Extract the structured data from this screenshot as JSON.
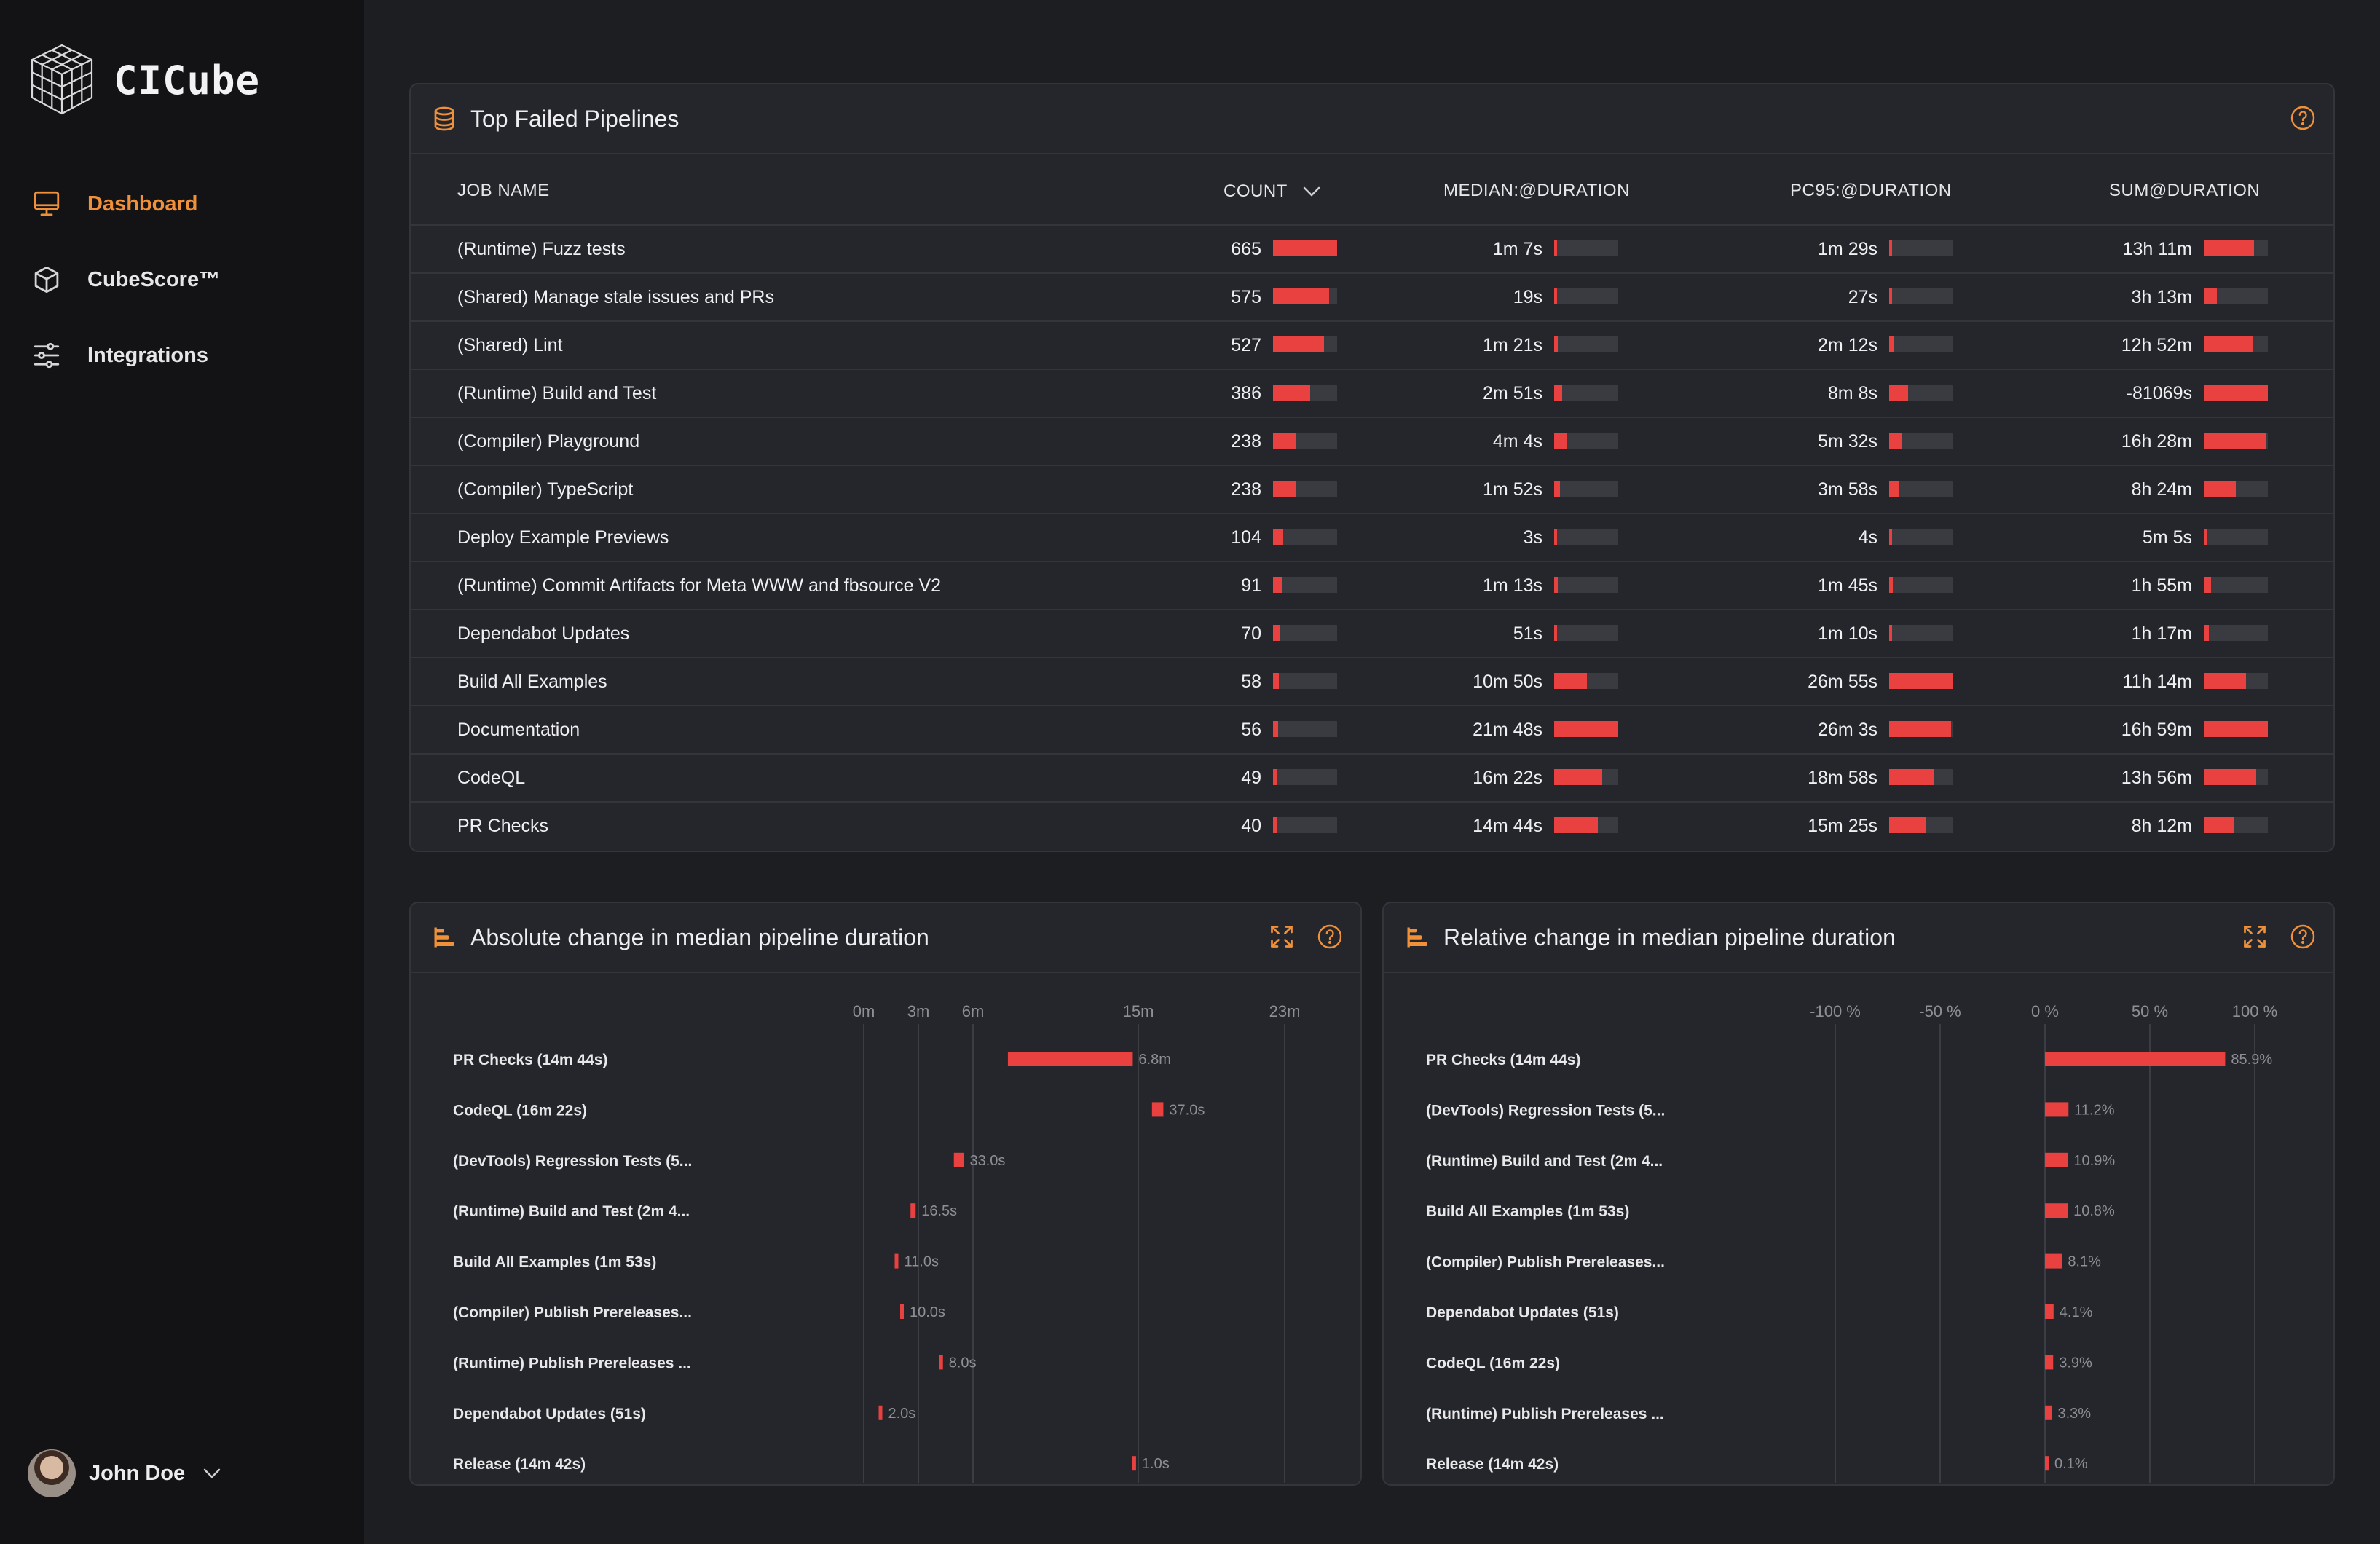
{
  "app": {
    "name": "CICube"
  },
  "sidebar": {
    "items": [
      {
        "label": "Dashboard",
        "icon": "monitor-icon",
        "active": true
      },
      {
        "label": "CubeScore™",
        "icon": "cube-icon",
        "active": false
      },
      {
        "label": "Integrations",
        "icon": "sliders-icon",
        "active": false
      }
    ]
  },
  "user": {
    "name": "John Doe"
  },
  "colors": {
    "accent": "#f0913a",
    "bar": "#e94040",
    "background": "#1d1e22",
    "panel": "#25262b"
  },
  "top_failed": {
    "title": "Top Failed Pipelines",
    "columns": {
      "job": "JOB NAME",
      "count": "COUNT",
      "median": "MEDIAN:@DURATION",
      "pc95": "PC95:@DURATION",
      "sum": "SUM@DURATION"
    },
    "rows": [
      {
        "name": "(Runtime) Fuzz tests",
        "count": "665",
        "count_frac": 1.0,
        "median": "1m 7s",
        "median_frac": 0.05,
        "pc95": "1m 29s",
        "pc95_frac": 0.05,
        "sum": "13h 11m",
        "sum_frac": 0.78
      },
      {
        "name": "(Shared) Manage stale issues and PRs",
        "count": "575",
        "count_frac": 0.87,
        "median": "19s",
        "median_frac": 0.02,
        "pc95": "27s",
        "pc95_frac": 0.02,
        "sum": "3h 13m",
        "sum_frac": 0.2
      },
      {
        "name": "(Shared) Lint",
        "count": "527",
        "count_frac": 0.79,
        "median": "1m 21s",
        "median_frac": 0.06,
        "pc95": "2m 12s",
        "pc95_frac": 0.08,
        "sum": "12h 52m",
        "sum_frac": 0.76
      },
      {
        "name": "(Runtime) Build and Test",
        "count": "386",
        "count_frac": 0.58,
        "median": "2m 51s",
        "median_frac": 0.13,
        "pc95": "8m 8s",
        "pc95_frac": 0.3,
        "sum": "-81069s",
        "sum_frac": 1.0
      },
      {
        "name": "(Compiler) Playground",
        "count": "238",
        "count_frac": 0.36,
        "median": "4m 4s",
        "median_frac": 0.19,
        "pc95": "5m 32s",
        "pc95_frac": 0.2,
        "sum": "16h 28m",
        "sum_frac": 0.97
      },
      {
        "name": "(Compiler) TypeScript",
        "count": "238",
        "count_frac": 0.36,
        "median": "1m 52s",
        "median_frac": 0.09,
        "pc95": "3m 58s",
        "pc95_frac": 0.15,
        "sum": "8h 24m",
        "sum_frac": 0.5
      },
      {
        "name": "Deploy Example Previews",
        "count": "104",
        "count_frac": 0.16,
        "median": "3s",
        "median_frac": 0.0,
        "pc95": "4s",
        "pc95_frac": 0.0,
        "sum": "5m 5s",
        "sum_frac": 0.0
      },
      {
        "name": "(Runtime) Commit Artifacts for Meta WWW and fbsource V2",
        "count": "91",
        "count_frac": 0.14,
        "median": "1m 13s",
        "median_frac": 0.06,
        "pc95": "1m 45s",
        "pc95_frac": 0.06,
        "sum": "1h 55m",
        "sum_frac": 0.11
      },
      {
        "name": "Dependabot Updates",
        "count": "70",
        "count_frac": 0.11,
        "median": "51s",
        "median_frac": 0.04,
        "pc95": "1m 10s",
        "pc95_frac": 0.04,
        "sum": "1h 17m",
        "sum_frac": 0.08
      },
      {
        "name": "Build All Examples",
        "count": "58",
        "count_frac": 0.09,
        "median": "10m 50s",
        "median_frac": 0.51,
        "pc95": "26m 55s",
        "pc95_frac": 1.0,
        "sum": "11h 14m",
        "sum_frac": 0.66
      },
      {
        "name": "Documentation",
        "count": "56",
        "count_frac": 0.08,
        "median": "21m 48s",
        "median_frac": 1.0,
        "pc95": "26m 3s",
        "pc95_frac": 0.97,
        "sum": "16h 59m",
        "sum_frac": 1.0
      },
      {
        "name": "CodeQL",
        "count": "49",
        "count_frac": 0.07,
        "median": "16m 22s",
        "median_frac": 0.75,
        "pc95": "18m 58s",
        "pc95_frac": 0.7,
        "sum": "13h 56m",
        "sum_frac": 0.82
      },
      {
        "name": "PR Checks",
        "count": "40",
        "count_frac": 0.06,
        "median": "14m 44s",
        "median_frac": 0.68,
        "pc95": "15m 25s",
        "pc95_frac": 0.57,
        "sum": "8h 12m",
        "sum_frac": 0.48
      }
    ]
  },
  "chart_data": [
    {
      "type": "bar",
      "title": "Absolute change in median pipeline duration",
      "orientation": "horizontal",
      "unit": "minutes",
      "x_ticks": [
        {
          "label": "0m",
          "value": 0
        },
        {
          "label": "3m",
          "value": 3
        },
        {
          "label": "6m",
          "value": 6
        },
        {
          "label": "15m",
          "value": 15
        },
        {
          "label": "23m",
          "value": 23
        }
      ],
      "xlim": [
        0,
        23
      ],
      "bars": [
        {
          "label": "PR Checks (14m 44s)",
          "start": 7.9,
          "end": 14.7,
          "value_label": "6.8m"
        },
        {
          "label": "CodeQL (16m 22s)",
          "start": 15.75,
          "end": 16.37,
          "value_label": "37.0s"
        },
        {
          "label": "(DevTools) Regression Tests (5...",
          "start": 4.95,
          "end": 5.5,
          "value_label": "33.0s"
        },
        {
          "label": "(Runtime) Build and Test (2m 4...",
          "start": 2.57,
          "end": 2.85,
          "value_label": "16.5s"
        },
        {
          "label": "Build All Examples (1m 53s)",
          "start": 1.7,
          "end": 1.88,
          "value_label": "11.0s"
        },
        {
          "label": "(Compiler) Publish Prereleases...",
          "start": 2.0,
          "end": 2.17,
          "value_label": "10.0s"
        },
        {
          "label": "(Runtime) Publish Prereleases ...",
          "start": 4.15,
          "end": 4.28,
          "value_label": "8.0s"
        },
        {
          "label": "Dependabot Updates (51s)",
          "start": 0.82,
          "end": 0.85,
          "value_label": "2.0s"
        },
        {
          "label": "Release (14m 42s)",
          "start": 14.68,
          "end": 14.7,
          "value_label": "1.0s"
        }
      ]
    },
    {
      "type": "bar",
      "title": "Relative change in median pipeline duration",
      "orientation": "horizontal",
      "unit": "percent",
      "x_ticks": [
        {
          "label": "-100 %",
          "value": -100
        },
        {
          "label": "-50 %",
          "value": -50
        },
        {
          "label": "0 %",
          "value": 0
        },
        {
          "label": "50 %",
          "value": 50
        },
        {
          "label": "100 %",
          "value": 100
        }
      ],
      "xlim": [
        -100,
        100
      ],
      "bars": [
        {
          "label": "PR Checks (14m 44s)",
          "value": 85.9,
          "value_label": "85.9%"
        },
        {
          "label": "(DevTools) Regression Tests (5...",
          "value": 11.2,
          "value_label": "11.2%"
        },
        {
          "label": "(Runtime) Build and Test (2m 4...",
          "value": 10.9,
          "value_label": "10.9%"
        },
        {
          "label": "Build All Examples (1m 53s)",
          "value": 10.8,
          "value_label": "10.8%"
        },
        {
          "label": "(Compiler) Publish Prereleases...",
          "value": 8.1,
          "value_label": "8.1%"
        },
        {
          "label": "Dependabot Updates (51s)",
          "value": 4.1,
          "value_label": "4.1%"
        },
        {
          "label": "CodeQL (16m 22s)",
          "value": 3.9,
          "value_label": "3.9%"
        },
        {
          "label": "(Runtime) Publish Prereleases ...",
          "value": 3.3,
          "value_label": "3.3%"
        },
        {
          "label": "Release (14m 42s)",
          "value": 0.1,
          "value_label": "0.1%"
        }
      ]
    }
  ]
}
